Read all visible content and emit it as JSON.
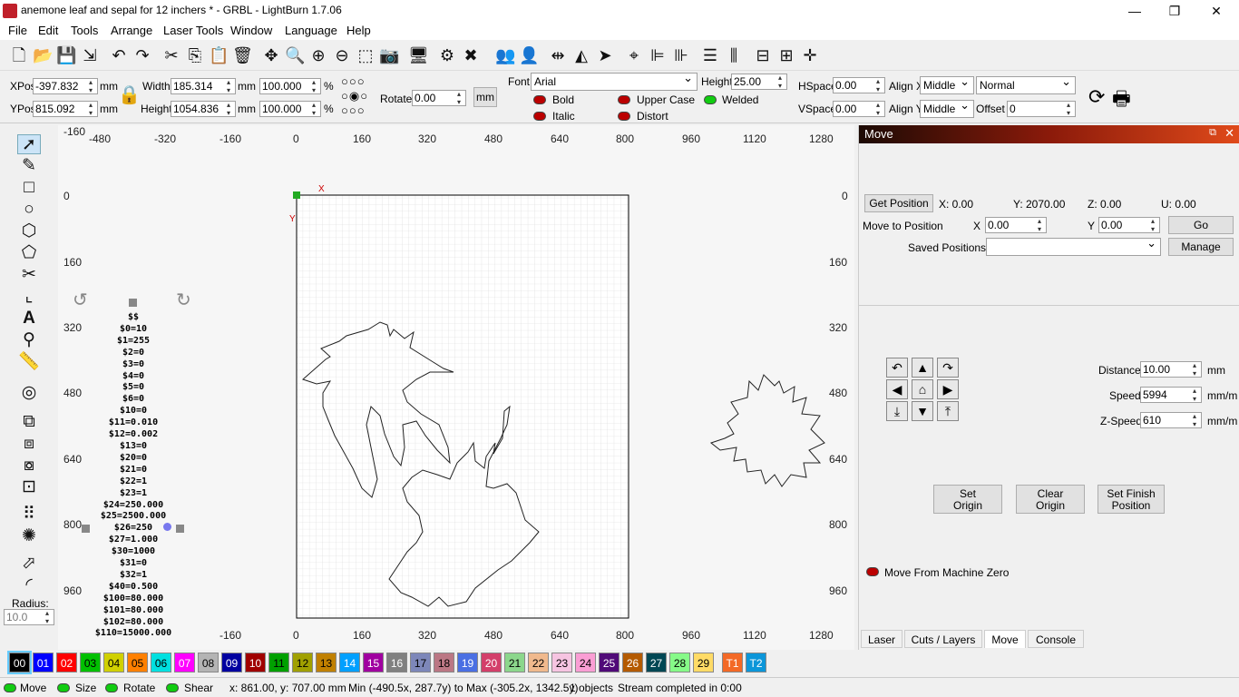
{
  "window": {
    "title": "anemone leaf and sepal for 12 inchers * - GRBL - LightBurn 1.7.06",
    "min": "—",
    "max": "❐",
    "close": "✕"
  },
  "menu": [
    "File",
    "Edit",
    "Tools",
    "Arrange",
    "Laser Tools",
    "Window",
    "Language",
    "Help"
  ],
  "props": {
    "xpos_label": "XPos",
    "xpos": "-397.832",
    "ypos_label": "YPos",
    "ypos": "815.092",
    "unit": "mm",
    "width_label": "Width",
    "width": "185.314",
    "height_label": "Height",
    "height": "1054.836",
    "wpct": "100.000",
    "hpct": "100.000",
    "pct": "%",
    "rotate_label": "Rotate",
    "rotate": "0.00",
    "mm_btn": "mm",
    "font_label": "Font",
    "font": "Arial",
    "fheight_label": "Height",
    "fheight": "25.00",
    "bold": "Bold",
    "italic": "Italic",
    "upper": "Upper Case",
    "distort": "Distort",
    "welded": "Welded",
    "hspace_label": "HSpace",
    "hspace": "0.00",
    "vspace_label": "VSpace",
    "vspace": "0.00",
    "alignx_label": "Align X",
    "alignx": "Middle",
    "aligny_label": "Align Y",
    "aligny": "Middle",
    "mode": "Normal",
    "offset_label": "Offset",
    "offset": "0"
  },
  "ruler": {
    "top": [
      "-480",
      "-320",
      "-160",
      "0",
      "160",
      "320",
      "480",
      "640",
      "800",
      "960",
      "1120",
      "1280"
    ],
    "bottom": [
      "-160",
      "0",
      "160",
      "320",
      "480",
      "640",
      "800",
      "960",
      "1120",
      "1280"
    ],
    "left": [
      "0",
      "160",
      "320",
      "480",
      "640",
      "800",
      "960"
    ],
    "corner_top": "-160"
  },
  "canvas": {
    "x_axis": "X",
    "y_axis": "Y",
    "gcode": [
      "$$",
      "$0=10",
      "$1=255",
      "$2=0",
      "$3=0",
      "$4=0",
      "$5=0",
      "$6=0",
      "$10=0",
      "$11=0.010",
      "$12=0.002",
      "$13=0",
      "$20=0",
      "$21=0",
      "$22=1",
      "$23=1",
      "$24=250.000",
      "$25=2500.000",
      "$26=250",
      "$27=1.000",
      "$30=1000",
      "$31=0",
      "$32=1",
      "$40=0.500",
      "$100=80.000",
      "$101=80.000",
      "$102=80.000",
      "$110=15000.000"
    ]
  },
  "move": {
    "title": "Move",
    "get_position": "Get Position",
    "x": "X: 0.00",
    "y": "Y: 2070.00",
    "z": "Z: 0.00",
    "u": "U: 0.00",
    "move_to": "Move to Position",
    "x_label": "X",
    "x_val": "0.00",
    "y_label": "Y",
    "y_val": "0.00",
    "go": "Go",
    "saved": "Saved Positions:",
    "manage": "Manage",
    "distance_label": "Distance",
    "distance": "10.00",
    "dist_unit": "mm",
    "speed_label": "Speed",
    "speed": "5994",
    "speed_unit": "mm/m",
    "zspeed_label": "Z-Speed",
    "zspeed": "610",
    "zspeed_unit": "mm/m",
    "set_origin_1": "Set",
    "set_origin_2": "Origin",
    "clear_origin_1": "Clear",
    "clear_origin_2": "Origin",
    "set_finish_1": "Set Finish",
    "set_finish_2": "Position",
    "from_zero": "Move From Machine Zero"
  },
  "tabs": [
    "Laser",
    "Cuts / Layers",
    "Move",
    "Console"
  ],
  "palette": [
    {
      "l": "00",
      "c": "#000000",
      "t": "#fff"
    },
    {
      "l": "01",
      "c": "#0000ff",
      "t": "#fff"
    },
    {
      "l": "02",
      "c": "#ff0000",
      "t": "#fff"
    },
    {
      "l": "03",
      "c": "#00c000",
      "t": "#000"
    },
    {
      "l": "04",
      "c": "#d0d000",
      "t": "#000"
    },
    {
      "l": "05",
      "c": "#ff8000",
      "t": "#000"
    },
    {
      "l": "06",
      "c": "#00e0e0",
      "t": "#000"
    },
    {
      "l": "07",
      "c": "#ff00ff",
      "t": "#fff"
    },
    {
      "l": "08",
      "c": "#b4b4b4",
      "t": "#000"
    },
    {
      "l": "09",
      "c": "#0000a0",
      "t": "#fff"
    },
    {
      "l": "10",
      "c": "#a00000",
      "t": "#fff"
    },
    {
      "l": "11",
      "c": "#00a000",
      "t": "#000"
    },
    {
      "l": "12",
      "c": "#a0a000",
      "t": "#000"
    },
    {
      "l": "13",
      "c": "#c08000",
      "t": "#000"
    },
    {
      "l": "14",
      "c": "#00a0ff",
      "t": "#fff"
    },
    {
      "l": "15",
      "c": "#a000a0",
      "t": "#fff"
    },
    {
      "l": "16",
      "c": "#808080",
      "t": "#fff"
    },
    {
      "l": "17",
      "c": "#7d87b9",
      "t": "#000"
    },
    {
      "l": "18",
      "c": "#bb7784",
      "t": "#000"
    },
    {
      "l": "19",
      "c": "#4a6fe3",
      "t": "#fff"
    },
    {
      "l": "20",
      "c": "#d33f6a",
      "t": "#fff"
    },
    {
      "l": "21",
      "c": "#8cd78c",
      "t": "#000"
    },
    {
      "l": "22",
      "c": "#f0b98d",
      "t": "#000"
    },
    {
      "l": "23",
      "c": "#f6c4e1",
      "t": "#000"
    },
    {
      "l": "24",
      "c": "#fa9ed4",
      "t": "#000"
    },
    {
      "l": "25",
      "c": "#500a78",
      "t": "#fff"
    },
    {
      "l": "26",
      "c": "#b45a00",
      "t": "#fff"
    },
    {
      "l": "27",
      "c": "#004754",
      "t": "#fff"
    },
    {
      "l": "28",
      "c": "#86fa88",
      "t": "#000"
    },
    {
      "l": "29",
      "c": "#ffdb66",
      "t": "#000"
    },
    {
      "l": "T1",
      "c": "#f36926",
      "t": "#fff"
    },
    {
      "l": "T2",
      "c": "#0c96d9",
      "t": "#fff"
    }
  ],
  "status": {
    "move": "Move",
    "size": "Size",
    "rotate": "Rotate",
    "shear": "Shear",
    "coords": "x: 861.00, y: 707.00 mm",
    "bounds": "Min (-490.5x, 287.7y) to Max (-305.2x, 1342.5y)",
    "objects": "1 objects",
    "stream": "Stream completed in 0:00"
  },
  "radius_label": "Radius:",
  "radius": "10.0"
}
